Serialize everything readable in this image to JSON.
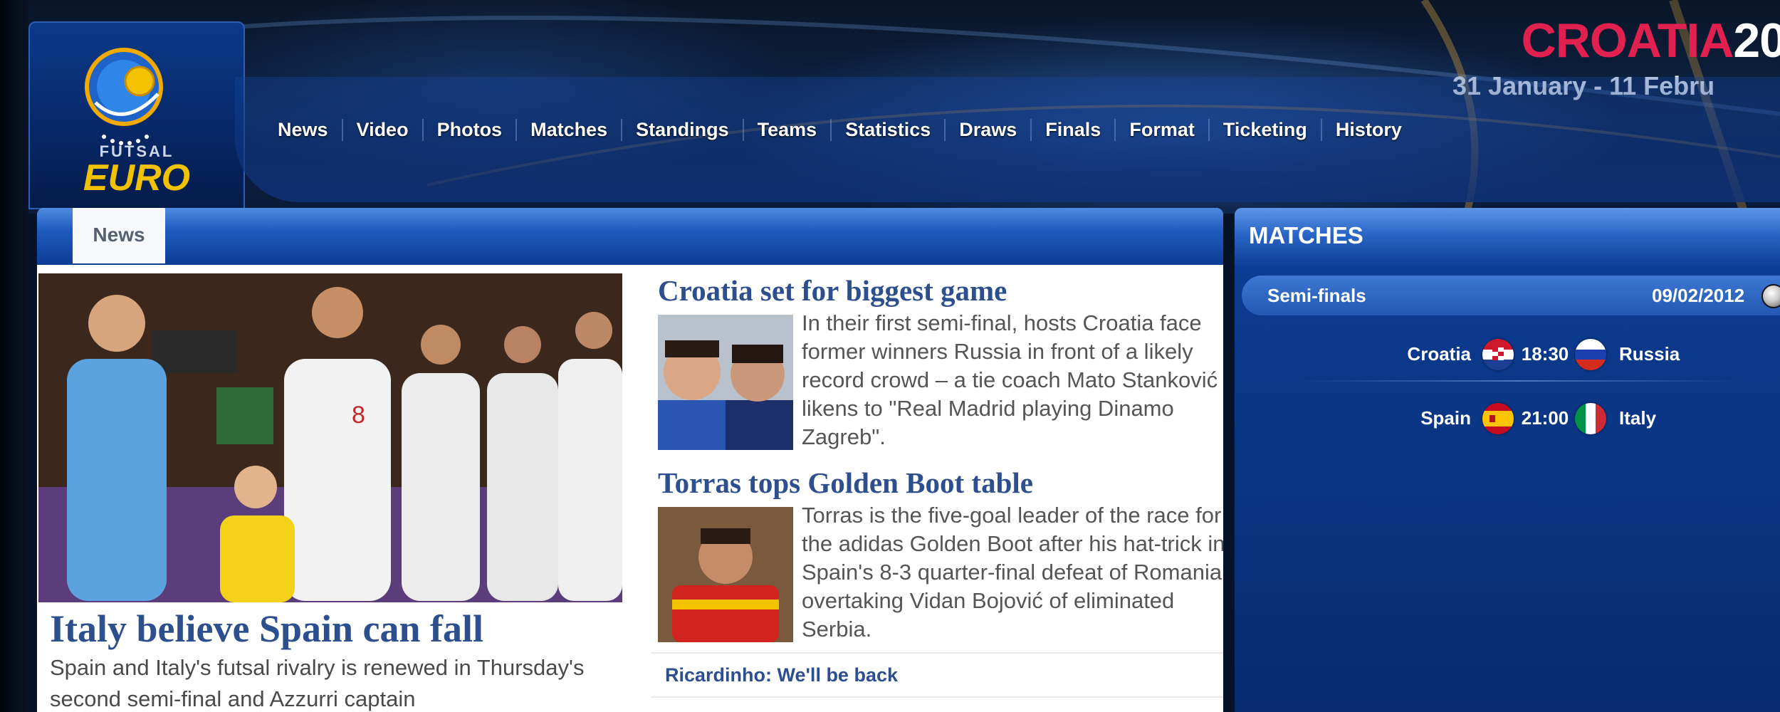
{
  "header": {
    "logo": {
      "line1": "FUTSAL",
      "line2": "EURO",
      "icon": "uefa-futsal-euro-logo"
    },
    "brand": {
      "part1": "CROATIA",
      "part2": "20"
    },
    "dates": "31 January - 11 Febru",
    "nav": [
      "News",
      "Video",
      "Photos",
      "Matches",
      "Standings",
      "Teams",
      "Statistics",
      "Draws",
      "Finals",
      "Format",
      "Ticketing",
      "History"
    ]
  },
  "content": {
    "tab": "News",
    "feature": {
      "title": "Italy believe Spain can fall",
      "summary": "Spain and Italy's futsal rivalry is renewed in Thursday's second semi-final and Azzurri captain"
    },
    "stories": [
      {
        "title": "Croatia set for biggest game",
        "body": "In their first semi-final, hosts Croatia face former winners Russia in front of a likely record crowd – a tie coach Mato Stanković likens to \"Real Madrid playing Dinamo Zagreb\"."
      },
      {
        "title": "Torras tops Golden Boot table",
        "body": "Torras is the five-goal leader of the race for the adidas Golden Boot after his hat-trick in Spain's 8-3 quarter-final defeat of Romania, overtaking Vidan Bojović of eliminated Serbia."
      }
    ],
    "related_link": "Ricardinho: We'll be back"
  },
  "matches": {
    "title": "MATCHES",
    "round": "Semi-finals",
    "date": "09/02/2012",
    "games": [
      {
        "home": "Croatia",
        "time": "18:30",
        "away": "Russia",
        "home_flag": "croatia-flag",
        "away_flag": "russia-flag"
      },
      {
        "home": "Spain",
        "time": "21:00",
        "away": "Italy",
        "home_flag": "spain-flag",
        "away_flag": "italy-flag"
      }
    ]
  },
  "colors": {
    "accent_blue": "#2d4f8e",
    "brand_red": "#e0204e",
    "euro_gold": "#f2c200",
    "panel_blue": "#0b3889"
  }
}
